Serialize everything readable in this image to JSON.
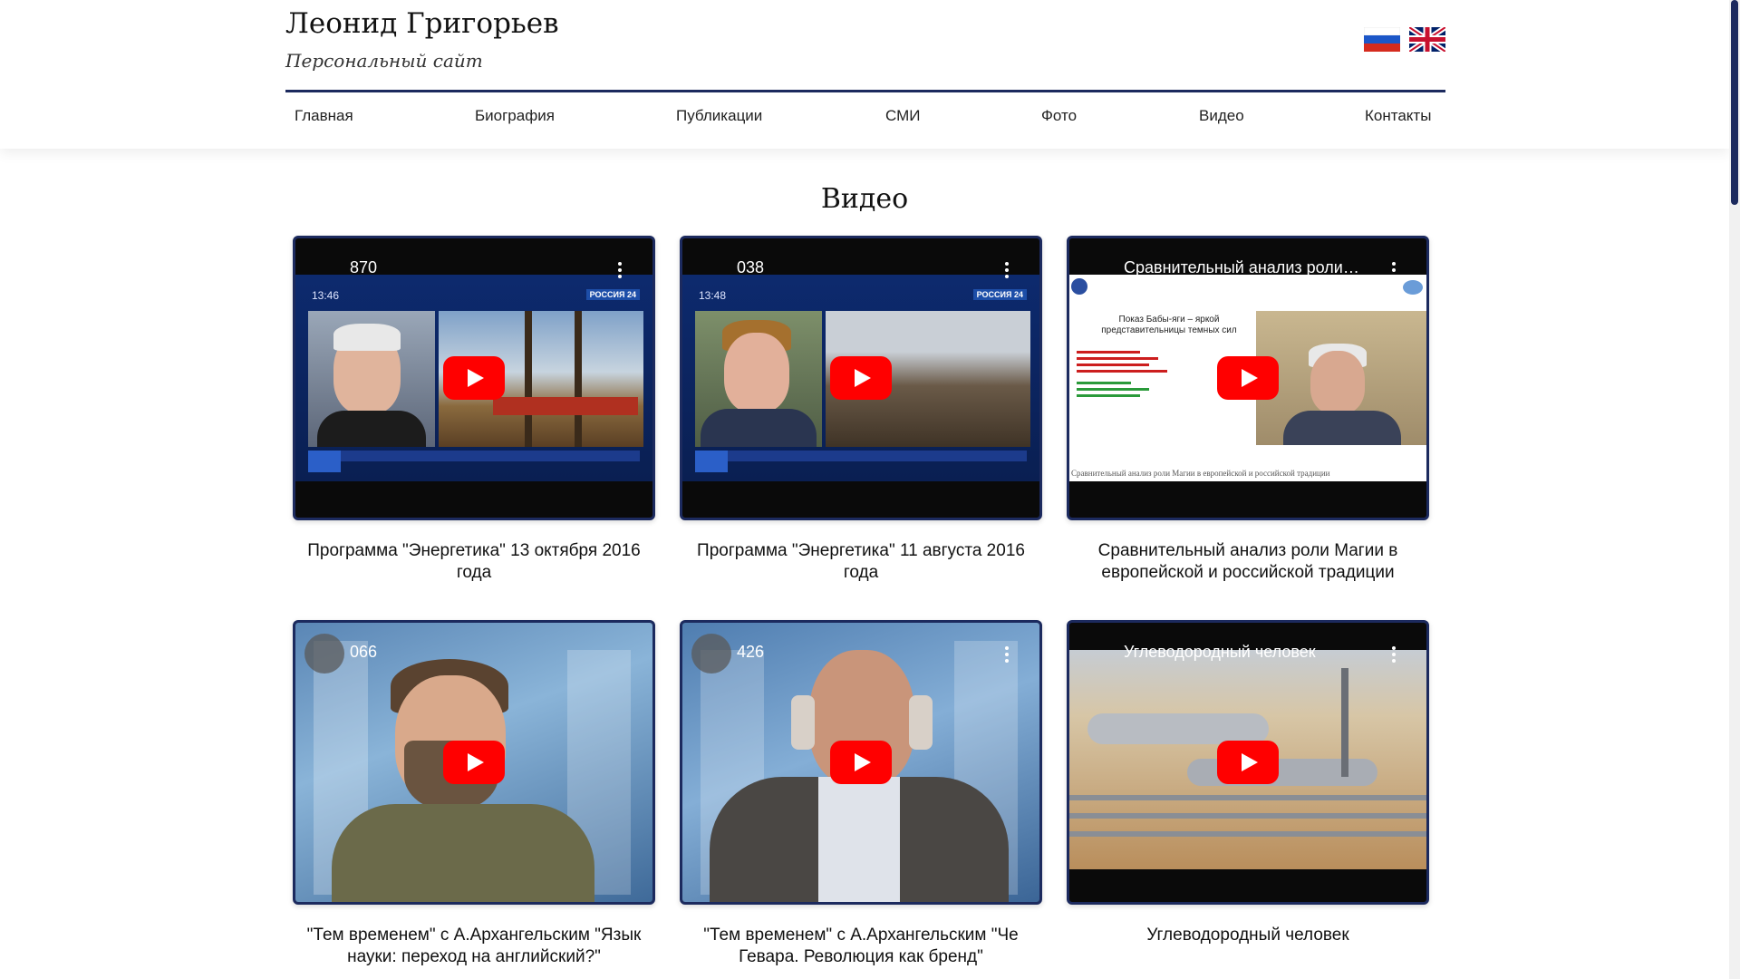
{
  "site": {
    "name": "Леонид Григорьев",
    "subtitle": "Персональный сайт"
  },
  "languages": [
    {
      "code": "ru",
      "icon": "russian-flag-icon"
    },
    {
      "code": "en",
      "icon": "uk-flag-icon"
    }
  ],
  "nav": [
    "Главная",
    "Биография",
    "Публикации",
    "СМИ",
    "Фото",
    "Видео",
    "Контакты"
  ],
  "page": {
    "title": "Видео"
  },
  "videos": [
    {
      "overlay_title": "870",
      "caption": "Программа \"Энергетика\" 13 октября 2016 года"
    },
    {
      "overlay_title": "038",
      "caption": "Программа \"Энергетика\" 11 августа 2016 года"
    },
    {
      "overlay_title": "Сравнительный анализ роли ...",
      "caption": "Сравнительный анализ роли Магии в европейской и российской традиции"
    },
    {
      "overlay_title": "066",
      "caption": "\"Тем временем\" с А.Архангельским \"Язык науки: переход на английский?\""
    },
    {
      "overlay_title": "426",
      "caption": "\"Тем временем\" с А.Архангельским \"Че Гевара. Революция как бренд\""
    },
    {
      "overlay_title": "Углеводородный человек",
      "caption": "Углеводородный человек"
    }
  ],
  "thumb_text": {
    "v1_time": "13:46",
    "v1_channel": "РОССИЯ 24",
    "v2_time": "13:48",
    "v2_channel": "РОССИЯ 24",
    "v3_heading": "Показ Бабы-яги – яркой представительницы темных сил",
    "v3_footer": "Сравнительный анализ роли Магии в европейской и российской традиции"
  },
  "colors": {
    "accent": "#1c2a5e",
    "play_button": "#ff0000"
  }
}
